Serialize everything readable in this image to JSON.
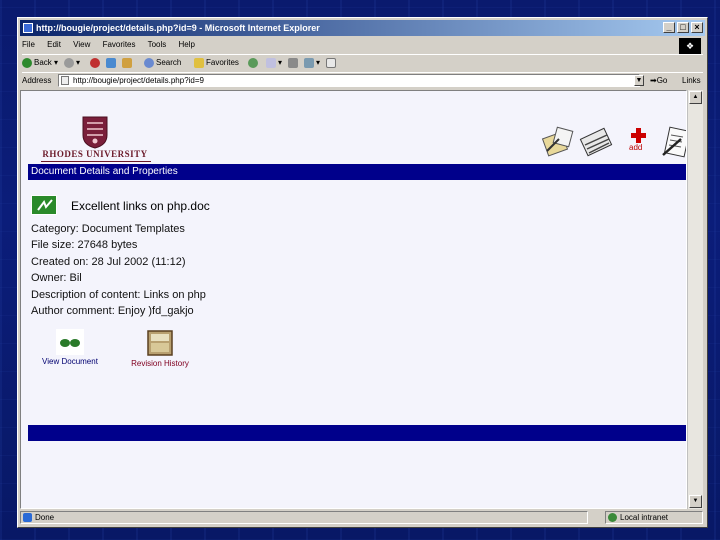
{
  "window": {
    "title": "http://bougie/project/details.php?id=9 - Microsoft Internet Explorer",
    "controls": [
      "_",
      "□",
      "×"
    ]
  },
  "menu": [
    "File",
    "Edit",
    "View",
    "Favorites",
    "Tools",
    "Help"
  ],
  "toolbar": {
    "back": "Back",
    "search": "Search",
    "favorites": "Favorites"
  },
  "address": {
    "label": "Address",
    "url": "http://bougie/project/details.php?id=9",
    "go": "Go",
    "links": "Links »"
  },
  "page": {
    "logo_text": "RHODES UNIVERSITY",
    "add_label": "add",
    "header": "Document Details and Properties",
    "doc_title": "Excellent links on php.doc",
    "properties": [
      "Category: Document Templates",
      "File size: 27648 bytes",
      "Created on: 28 Jul 2002 (11:12)",
      "Owner: Bil",
      "Description of content: Links on php",
      "Author comment: Enjoy )fd_gakjo"
    ],
    "view_document": "View Document",
    "revision_history": "Revision History"
  },
  "status": {
    "text": "Done",
    "zone": "Local intranet"
  },
  "colors": {
    "header_bar": "#00008b",
    "logo": "#6b1a2a",
    "add": "#cc0000"
  }
}
